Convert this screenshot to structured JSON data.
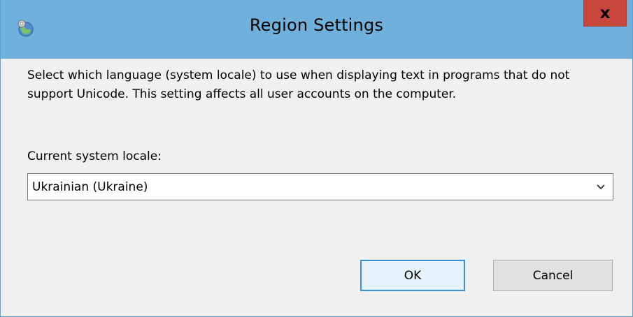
{
  "window": {
    "title": "Region Settings",
    "close_label": "x",
    "app_icon": "globe-settings-icon"
  },
  "content": {
    "description": "Select which language (system locale) to use when displaying text in programs that do not support Unicode. This setting affects all user accounts on the computer.",
    "locale_label": "Current system locale:",
    "locale_value": "Ukrainian (Ukraine)"
  },
  "buttons": {
    "ok_label": "OK",
    "cancel_label": "Cancel"
  },
  "colors": {
    "titlebar": "#6fb0dd",
    "close_button": "#c9463d",
    "ok_border": "#3c8fd0",
    "background": "#f0f0f0"
  }
}
